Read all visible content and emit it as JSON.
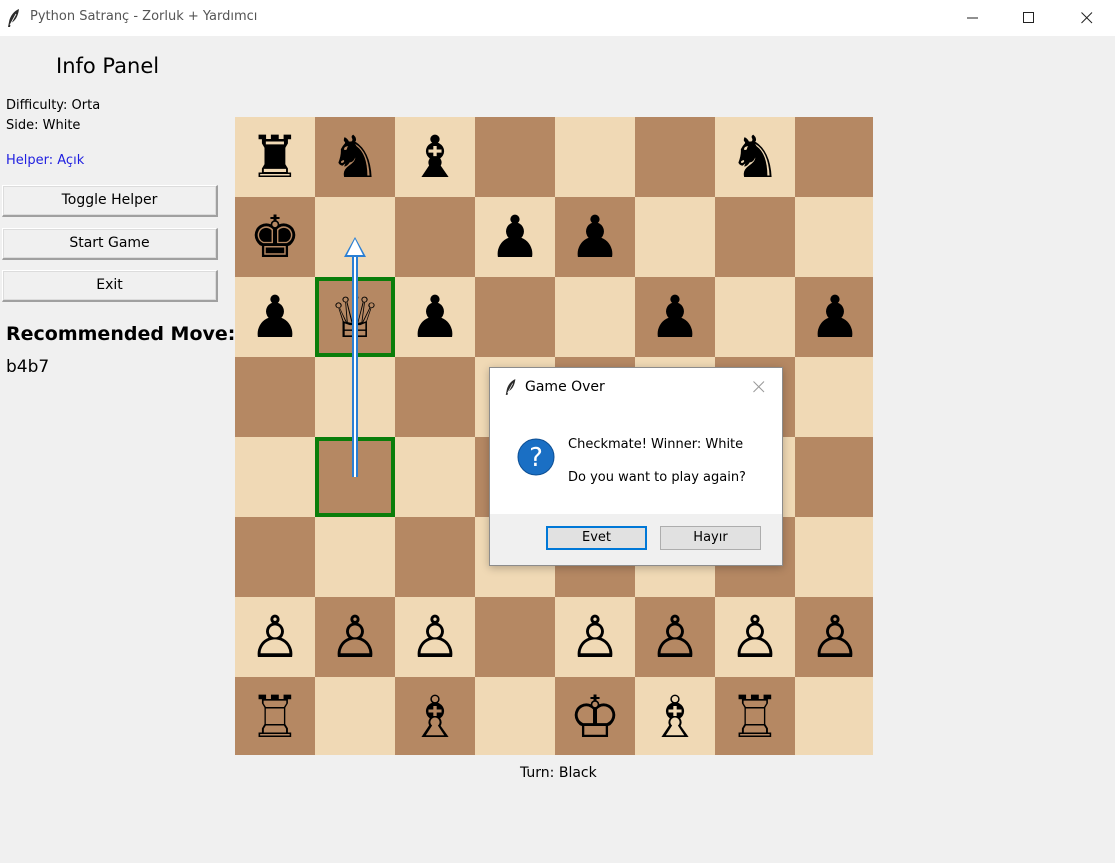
{
  "window": {
    "title": "Python Satranç - Zorluk + Yardımcı"
  },
  "info_panel": {
    "title": "Info Panel",
    "difficulty": "Difficulty: Orta",
    "side": "Side: White",
    "helper": "Helper: Açık",
    "buttons": {
      "toggle_helper": "Toggle Helper",
      "start_game": "Start Game",
      "exit": "Exit"
    },
    "recommended_label": "Recommended Move:",
    "recommended_value": "b4b7"
  },
  "board": {
    "colors": {
      "light": "#f0d9b5",
      "dark": "#b58863",
      "highlight": "#0a7d0a",
      "arrow": "#2a7fd4"
    },
    "pieces": [
      {
        "square": "a8",
        "glyph": "♜",
        "color": "b",
        "name": "black-rook"
      },
      {
        "square": "b8",
        "glyph": "♞",
        "color": "b",
        "name": "black-knight"
      },
      {
        "square": "c8",
        "glyph": "♝",
        "color": "b",
        "name": "black-bishop"
      },
      {
        "square": "g8",
        "glyph": "♞",
        "color": "b",
        "name": "black-knight"
      },
      {
        "square": "a7",
        "glyph": "♚",
        "color": "b",
        "name": "black-king"
      },
      {
        "square": "d7",
        "glyph": "♟",
        "color": "b",
        "name": "black-pawn"
      },
      {
        "square": "e7",
        "glyph": "♟",
        "color": "b",
        "name": "black-pawn"
      },
      {
        "square": "a6",
        "glyph": "♟",
        "color": "b",
        "name": "black-pawn"
      },
      {
        "square": "b6",
        "glyph": "♕",
        "color": "w",
        "name": "white-queen"
      },
      {
        "square": "c6",
        "glyph": "♟",
        "color": "b",
        "name": "black-pawn"
      },
      {
        "square": "f6",
        "glyph": "♟",
        "color": "b",
        "name": "black-pawn"
      },
      {
        "square": "h6",
        "glyph": "♟",
        "color": "b",
        "name": "black-pawn"
      },
      {
        "square": "a2",
        "glyph": "♙",
        "color": "w",
        "name": "white-pawn"
      },
      {
        "square": "b2",
        "glyph": "♙",
        "color": "w",
        "name": "white-pawn"
      },
      {
        "square": "c2",
        "glyph": "♙",
        "color": "w",
        "name": "white-pawn"
      },
      {
        "square": "e2",
        "glyph": "♙",
        "color": "w",
        "name": "white-pawn"
      },
      {
        "square": "f2",
        "glyph": "♙",
        "color": "w",
        "name": "white-pawn"
      },
      {
        "square": "g2",
        "glyph": "♙",
        "color": "w",
        "name": "white-pawn"
      },
      {
        "square": "h2",
        "glyph": "♙",
        "color": "w",
        "name": "white-pawn"
      },
      {
        "square": "a1",
        "glyph": "♖",
        "color": "w",
        "name": "white-rook"
      },
      {
        "square": "c1",
        "glyph": "♗",
        "color": "w",
        "name": "white-bishop"
      },
      {
        "square": "e1",
        "glyph": "♔",
        "color": "w",
        "name": "white-king"
      },
      {
        "square": "f1",
        "glyph": "♗",
        "color": "w",
        "name": "white-bishop"
      },
      {
        "square": "g1",
        "glyph": "♖",
        "color": "w",
        "name": "white-rook"
      }
    ],
    "highlights": [
      "b6",
      "b4"
    ],
    "arrow": {
      "from": "b4",
      "to": "b7"
    }
  },
  "status": {
    "turn": "Turn: Black"
  },
  "dialog": {
    "title": "Game Over",
    "message1": "Checkmate! Winner: White",
    "message2": "Do you want to play again?",
    "yes_label": "Evet",
    "no_label": "Hayır",
    "icon": "question-icon",
    "icon_color": "#1a6fc4"
  }
}
